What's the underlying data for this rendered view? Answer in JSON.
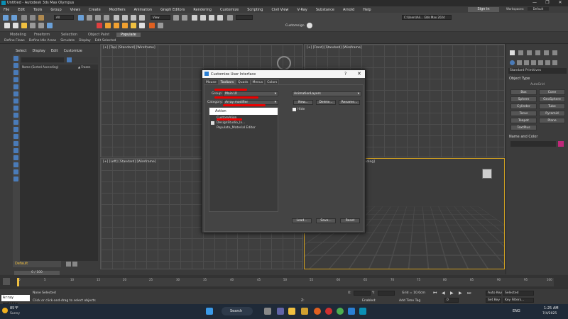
{
  "window": {
    "title": "Untitled - Autodesk 3ds Max Olympus",
    "min": "—",
    "max": "❐",
    "close": "✕"
  },
  "menu": {
    "items": [
      "File",
      "Edit",
      "Tools",
      "Group",
      "Views",
      "Create",
      "Modifiers",
      "Animation",
      "Graph Editors",
      "Rendering",
      "Customize",
      "Scripting",
      "Civil View",
      "V-Ray",
      "Substance",
      "Arnold",
      "Help"
    ],
    "sign_in": "Sign in",
    "workspaces_label": "Workspaces:",
    "workspaces_value": "Default"
  },
  "toolbar": {
    "selection_filter": "All",
    "ref_coord": "View",
    "named_selection": "Customsign",
    "project_path": "C:\\Users\\Ali... \\3ds Max 2024"
  },
  "ribbon": {
    "tabs": [
      "Modeling",
      "Freeform",
      "Selection",
      "Object Paint",
      "Populate"
    ],
    "active_tab": "Populate",
    "sub_items": [
      "Define Flows",
      "Define Idle Areas",
      "Simulate",
      "Display",
      "Edit Selected"
    ]
  },
  "scene_explorer": {
    "tabs": [
      "Select",
      "Display",
      "Edit",
      "Customize"
    ],
    "col_name": "Name (Sorted Ascending)",
    "col_frozen": "▲ Frozen",
    "layer": "Default"
  },
  "viewports": {
    "top": "[+] [Top] [Standard] [Wireframe]",
    "front": "[+] [Front] [Standard] [Wireframe]",
    "left": "[+] [Left] [Standard] [Wireframe]",
    "persp": "rending]"
  },
  "command_panel": {
    "category": "Standard Primitives",
    "object_type": "Object Type",
    "autogrid": "AutoGrid",
    "primitives": [
      "Box",
      "Cone",
      "Sphere",
      "GeoSphere",
      "Cylinder",
      "Tube",
      "Torus",
      "Pyramid",
      "Teapot",
      "Plane",
      "TextPlus"
    ],
    "name_color": "Name and Color"
  },
  "dialog": {
    "title": "Customize User Interface",
    "help": "?",
    "close": "✕",
    "tabs": [
      "Mouse",
      "Toolbars",
      "Quads",
      "Menus",
      "Colors"
    ],
    "active_tab": "Toolbars",
    "group_label": "Group:",
    "group_value": "Main UI",
    "category_label": "Category:",
    "category_value": "Array modifier",
    "action_header": "Action",
    "actions": [
      "CustomAlign",
      "DesignStudio_lx...",
      "Populate_Material Editor"
    ],
    "toolbar_dd": "AnimationLayers",
    "new_btn": "New...",
    "delete_btn": "Delete...",
    "rename_btn": "Rename...",
    "hide_label": "Hide",
    "load_btn": "Load...",
    "save_btn": "Save...",
    "reset_btn": "Reset"
  },
  "timeline": {
    "frame_display": "0 / 100",
    "ticks": [
      "0",
      "5",
      "10",
      "15",
      "20",
      "25",
      "30",
      "35",
      "40",
      "45",
      "50",
      "55",
      "60",
      "65",
      "70",
      "75",
      "80",
      "85",
      "90",
      "95",
      "100"
    ]
  },
  "statusbar": {
    "script_field": "Array modifie",
    "status1": "None Selected",
    "status2": "Click or click-and-drag to select objects",
    "x_label": "X:",
    "y_label": "Y:",
    "z_label": "Z:",
    "grid": "Grid = 10.0cm",
    "addtime": "Add Time Tag",
    "autokey": "Auto Key",
    "selected": "Selected",
    "setkey": "Set Key",
    "keyfilters": "Key Filters...",
    "frame": "0",
    "enabled": "Enabled:"
  },
  "taskbar": {
    "weather_temp": "85°F",
    "weather_desc": "Sunny",
    "search": "Search",
    "lang": "ENG",
    "time": "1:25 AM",
    "date": "7/4/2025"
  },
  "colors": {
    "accent_blue": "#2a7fd4",
    "red_mark": "#e00000",
    "layer_yellow": "#f0c040",
    "color_swatch": "#c0287a"
  }
}
